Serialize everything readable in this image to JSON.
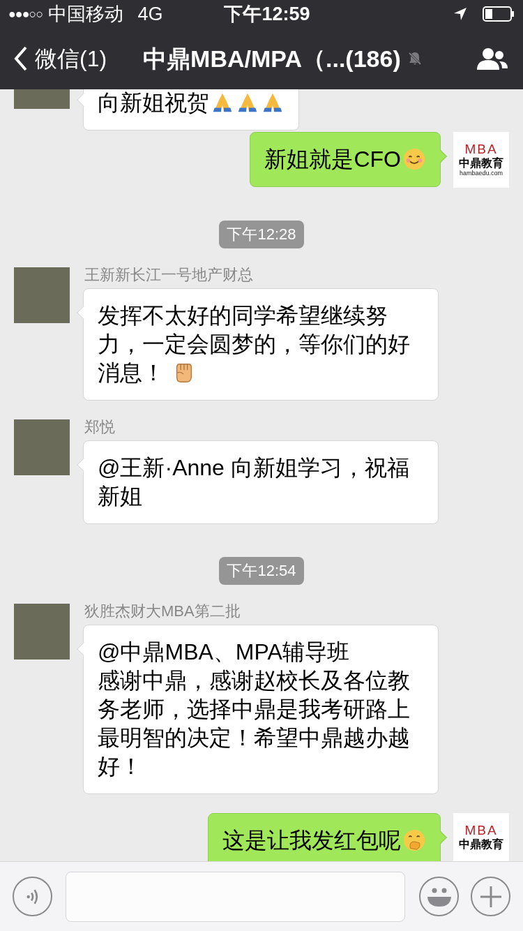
{
  "status_bar": {
    "signal": "●●●○○",
    "carrier": "中国移动",
    "network": "4G",
    "time": "下午12:59"
  },
  "nav": {
    "back_label": "微信(1)",
    "title": "中鼎MBA/MPA（...(186)",
    "muted": true
  },
  "messages": [
    {
      "kind": "incoming",
      "text": "向新姐祝贺",
      "emojis": [
        {
          "kind": "pray"
        },
        {
          "kind": "pray"
        },
        {
          "kind": "pray"
        }
      ]
    },
    {
      "kind": "outgoing",
      "text": "新姐就是CFO",
      "emojis": [
        {
          "kind": "smile"
        }
      ],
      "avatar": {
        "mark": "MBA",
        "name": "中鼎教育",
        "url": "hambaedu.com"
      }
    },
    {
      "kind": "time",
      "text": "下午12:28"
    },
    {
      "kind": "incoming",
      "name": "王新新长江一号地产财总",
      "text": "发挥不太好的同学希望继续努力，一定会圆梦的，等你们的好消息！",
      "emojis": [
        {
          "kind": "fist"
        }
      ]
    },
    {
      "kind": "incoming",
      "name": "郑悦",
      "text": "@王新·Anne 向新姐学习，祝福新姐"
    },
    {
      "kind": "time",
      "text": "下午12:54"
    },
    {
      "kind": "incoming",
      "name": "狄胜杰财大MBA第二批",
      "mention": "@中鼎MBA、MPA辅导班",
      "text": "感谢中鼎，感谢赵校长及各位教务老师，选择中鼎是我考研路上最明智的决定！希望中鼎越办越好！"
    },
    {
      "kind": "outgoing",
      "text": "这是让我发红包呢",
      "emojis": [
        {
          "kind": "smirk"
        }
      ],
      "avatar": {
        "mark": "MBA",
        "name": "中鼎教育"
      }
    }
  ]
}
